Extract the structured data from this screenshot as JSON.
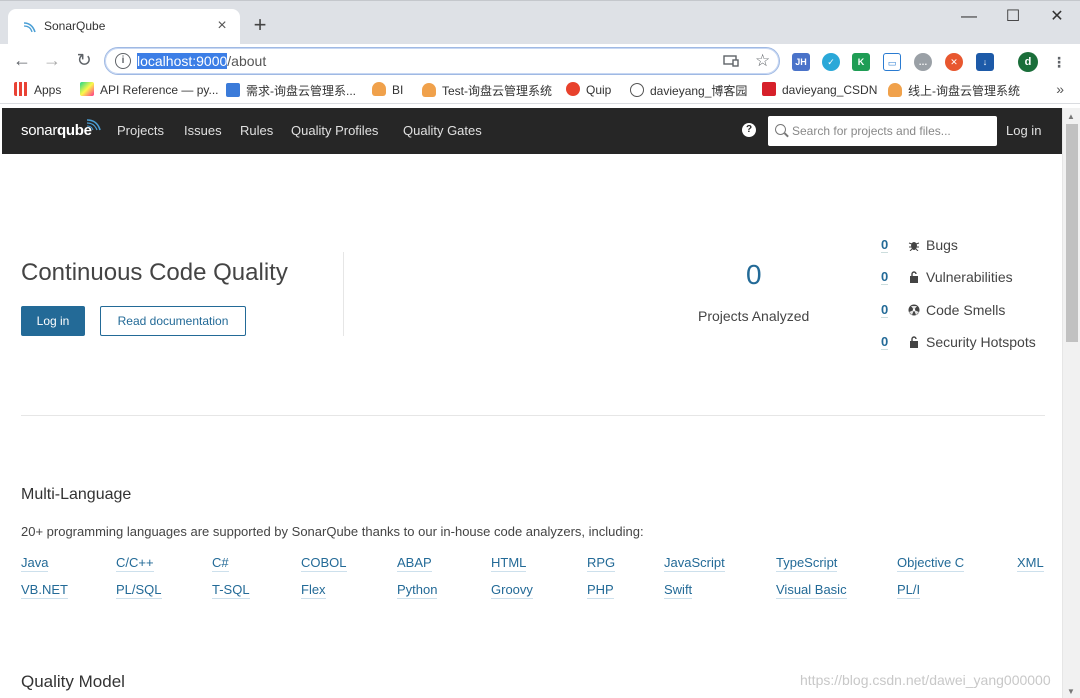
{
  "browser": {
    "tab_title": "SonarQube",
    "tab_close": "×",
    "new_tab": "+",
    "url_selected": "localhost:9000",
    "url_rest": "/about",
    "window_controls": {
      "minimize": "—",
      "maximize": "☐",
      "close": "✕"
    },
    "nav": {
      "back": "←",
      "forward": "→",
      "reload": "↻"
    },
    "bookmarks": [
      "Apps",
      "API Reference — py...",
      "需求-询盘云管理系...",
      "BI",
      "Test-询盘云管理系统",
      "Quip",
      "davieyang_博客园",
      "davieyang_CSDN",
      "线上-询盘云管理系统"
    ],
    "bookmarks_more": "»",
    "profile_letter": "d"
  },
  "sonar": {
    "logo_prefix": "sonar",
    "logo_suffix": "qube",
    "nav_links": [
      "Projects",
      "Issues",
      "Rules",
      "Quality Profiles",
      "Quality Gates"
    ],
    "help": "?",
    "search_placeholder": "Search for projects and files...",
    "login_link": "Log in"
  },
  "hero": {
    "title": "Continuous Code Quality",
    "login_button": "Log in",
    "docs_button": "Read documentation",
    "projects_count": "0",
    "projects_label": "Projects Analyzed",
    "metrics": [
      {
        "value": "0",
        "label": "Bugs",
        "icon": "bug-icon"
      },
      {
        "value": "0",
        "label": "Vulnerabilities",
        "icon": "lock-icon"
      },
      {
        "value": "0",
        "label": "Code Smells",
        "icon": "radiation-icon"
      },
      {
        "value": "0",
        "label": "Security Hotspots",
        "icon": "lock-icon"
      }
    ]
  },
  "multi_language": {
    "title": "Multi-Language",
    "description": "20+ programming languages are supported by SonarQube thanks to our in-house code analyzers, including:",
    "languages_row1": [
      "Java",
      "C/C++",
      "C#",
      "COBOL",
      "ABAP",
      "HTML",
      "RPG",
      "JavaScript",
      "TypeScript",
      "Objective C",
      "XML"
    ],
    "languages_row2": [
      "VB.NET",
      "PL/SQL",
      "T-SQL",
      "Flex",
      "Python",
      "Groovy",
      "PHP",
      "Swift",
      "Visual Basic",
      "PL/I"
    ]
  },
  "quality_model": {
    "title": "Quality Model"
  },
  "watermark": "https://blog.csdn.net/dawei_yang000000",
  "colors": {
    "accent": "#236a97",
    "nav_bg": "#262626"
  }
}
